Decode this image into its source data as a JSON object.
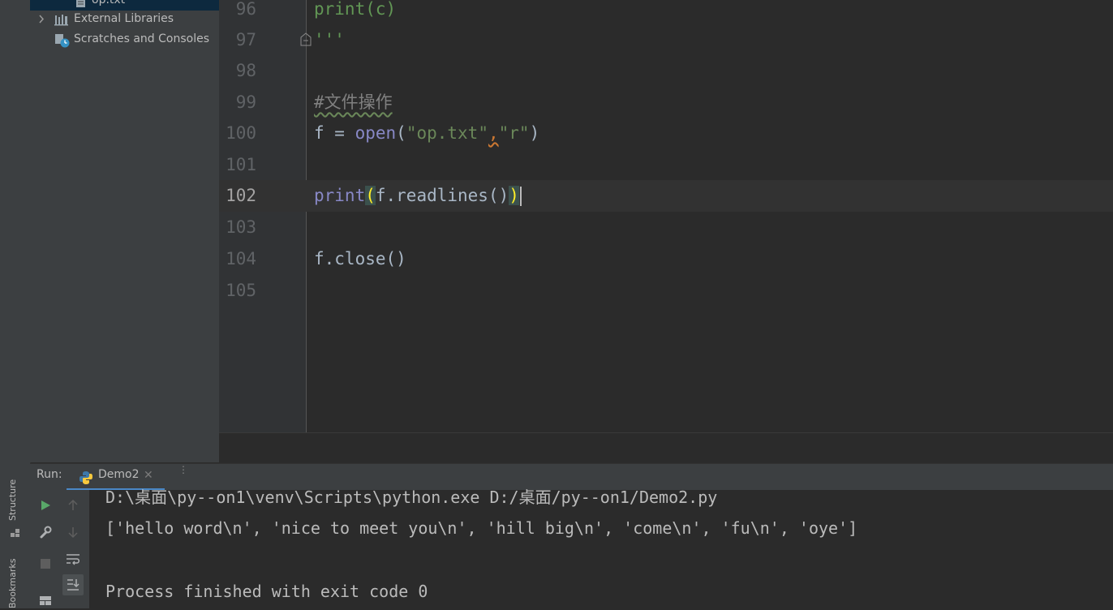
{
  "side_strip": {
    "structure_label": "Structure",
    "bookmarks_label": "Bookmarks"
  },
  "project_tree": {
    "items": [
      {
        "label": "op.txt",
        "icon": "text-file-icon"
      },
      {
        "label": "External Libraries",
        "icon": "library-icon"
      },
      {
        "label": "Scratches and Consoles",
        "icon": "scratches-icon"
      }
    ]
  },
  "editor": {
    "lines": [
      {
        "num": "96",
        "code": "print(c)"
      },
      {
        "num": "97",
        "code": "'''"
      },
      {
        "num": "98",
        "code": ""
      },
      {
        "num": "99",
        "code": "#文件操作"
      },
      {
        "num": "100",
        "code_parts": [
          "f = ",
          "open",
          "(",
          "\"op.txt\"",
          ",",
          "\"r\"",
          ")"
        ]
      },
      {
        "num": "101",
        "code": ""
      },
      {
        "num": "102",
        "code_parts": [
          "print",
          "(",
          "f.readlines()",
          ")"
        ]
      },
      {
        "num": "103",
        "code": ""
      },
      {
        "num": "104",
        "code": "f.close()"
      },
      {
        "num": "105",
        "code": ""
      }
    ],
    "current_line": "102"
  },
  "run_panel": {
    "label": "Run:",
    "tab": "Demo2",
    "console": [
      "D:\\桌面\\py--on1\\venv\\Scripts\\python.exe D:/桌面/py--on1/Demo2.py",
      "['hello word\\n', 'nice to meet you\\n', 'hill big\\n', 'come\\n', 'fu\\n', 'oye']",
      "",
      "Process finished with exit code 0"
    ]
  },
  "colors": {
    "background": "#2b2b2b",
    "panel": "#3c3f41",
    "builtin": "#8888c6",
    "string": "#6a8759",
    "comment": "#808080",
    "brace_match": "#ffef28"
  }
}
